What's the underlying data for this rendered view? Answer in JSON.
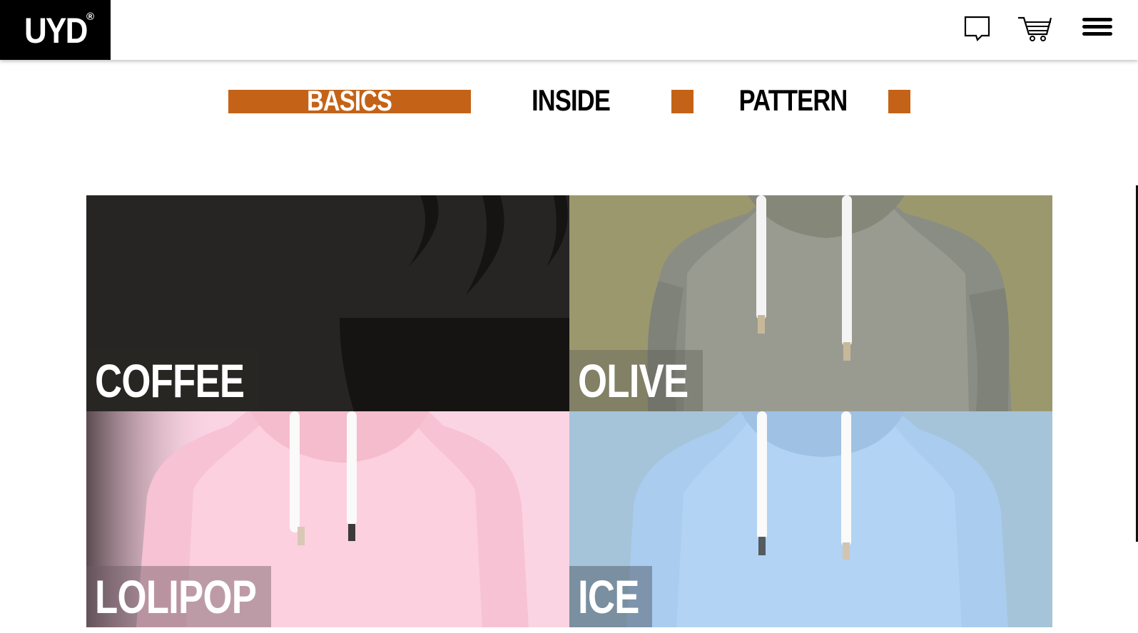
{
  "header": {
    "logo_text": "UYD",
    "logo_mark": "®",
    "icons": [
      "chat-icon",
      "cart-icon",
      "menu-icon"
    ]
  },
  "tabs": [
    {
      "label": "BASICS",
      "active": true
    },
    {
      "label": "INSIDE",
      "active": false
    },
    {
      "label": "PATTERN",
      "active": false
    }
  ],
  "products": [
    {
      "label": "COFFEE",
      "color": "#272524"
    },
    {
      "label": "OLIVE",
      "color": "#9c986d"
    },
    {
      "label": "LOLIPOP",
      "color": "#fbd4e3"
    },
    {
      "label": "ICE",
      "color": "#a5c4d9"
    }
  ],
  "accent_color": "#c46317"
}
